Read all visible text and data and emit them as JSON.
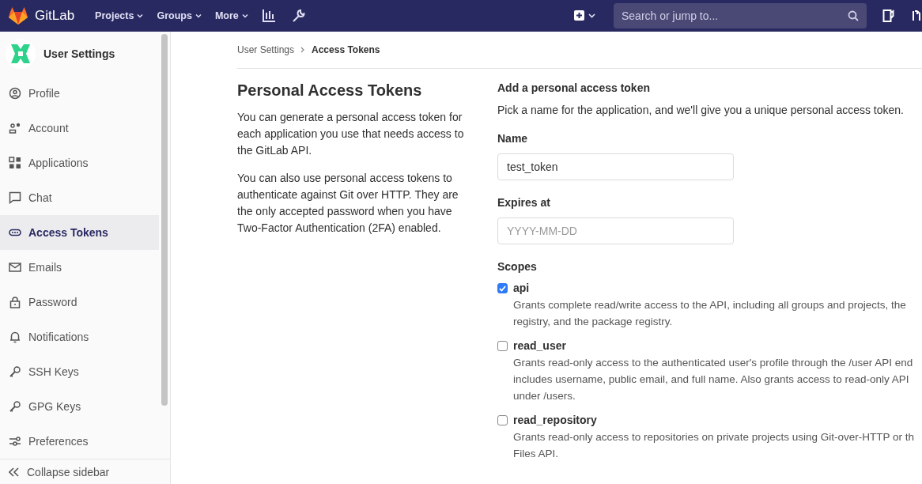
{
  "topbar": {
    "brand": "GitLab",
    "menus": [
      {
        "label": "Projects"
      },
      {
        "label": "Groups"
      },
      {
        "label": "More"
      }
    ],
    "search": {
      "placeholder": "Search or jump to..."
    }
  },
  "sidebar": {
    "title": "User Settings",
    "items": [
      {
        "label": "Profile",
        "selected": false
      },
      {
        "label": "Account",
        "selected": false
      },
      {
        "label": "Applications",
        "selected": false
      },
      {
        "label": "Chat",
        "selected": false
      },
      {
        "label": "Access Tokens",
        "selected": true
      },
      {
        "label": "Emails",
        "selected": false
      },
      {
        "label": "Password",
        "selected": false
      },
      {
        "label": "Notifications",
        "selected": false
      },
      {
        "label": "SSH Keys",
        "selected": false
      },
      {
        "label": "GPG Keys",
        "selected": false
      },
      {
        "label": "Preferences",
        "selected": false
      }
    ],
    "collapse": "Collapse sidebar"
  },
  "breadcrumb": [
    "User Settings",
    "Access Tokens"
  ],
  "intro": {
    "title": "Personal Access Tokens",
    "paragraphs": [
      "You can generate a personal access token for each application you use that needs access to the GitLab API.",
      "You can also use personal access tokens to authenticate against Git over HTTP. They are the only accepted password when you have Two-Factor Authentication (2FA) enabled."
    ]
  },
  "form": {
    "title": "Add a personal access token",
    "subtitle": "Pick a name for the application, and we'll give you a unique personal access token.",
    "fields": [
      {
        "label": "Name",
        "value": "test_token"
      },
      {
        "label": "Expires at",
        "placeholder": "YYYY-MM-DD"
      }
    ],
    "scopes_label": "Scopes",
    "scopes": [
      {
        "name": "api",
        "checked": true,
        "lines": [
          "Grants complete read/write access to the API, including all groups and projects, the",
          "registry, and the package registry."
        ]
      },
      {
        "name": "read_user",
        "checked": false,
        "lines": [
          "Grants read-only access to the authenticated user's profile through the /user API end",
          "includes username, public email, and full name. Also grants access to read-only API",
          "under /users."
        ]
      },
      {
        "name": "read_repository",
        "checked": false,
        "lines": [
          "Grants read-only access to repositories on private projects using Git-over-HTTP or th",
          "Files API."
        ]
      }
    ]
  }
}
